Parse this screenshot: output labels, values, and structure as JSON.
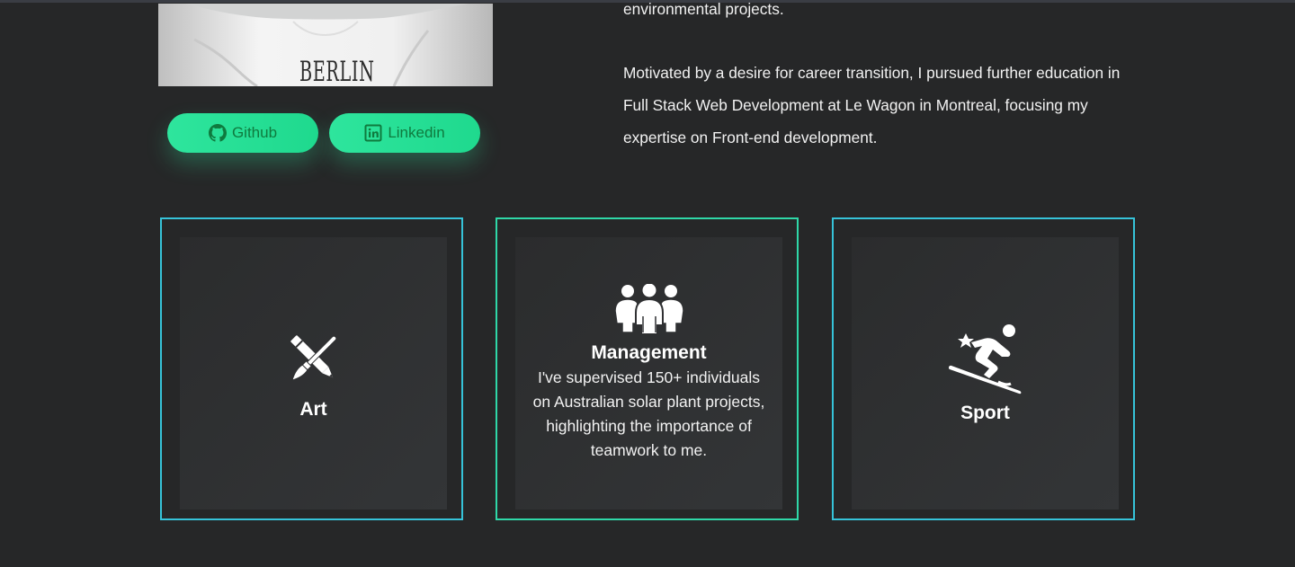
{
  "profile": {
    "shirt_text": "BERLIN"
  },
  "social": {
    "github_label": "Github",
    "linkedin_label": "Linkedin"
  },
  "about": {
    "para1_tail": "environmental projects.",
    "para2": "Motivated by a desire for career transition, I pursued further education in Full Stack Web Development at Le Wagon in Montreal, focusing my expertise on Front-end development."
  },
  "cards": [
    {
      "title": "Art",
      "icon": "pencil-brush-icon",
      "border_color": "#36c3d9"
    },
    {
      "title": "Management",
      "icon": "people-group-icon",
      "border_color": "#2fd8a8",
      "description": "I've supervised 150+ individuals on Australian solar plant projects, highlighting the importance of teamwork to me."
    },
    {
      "title": "Sport",
      "icon": "skiing-icon",
      "border_color": "#36c3d9"
    }
  ],
  "colors": {
    "background": "#262728",
    "accent_green": "#2ee59d",
    "button_text": "#0f7a3e",
    "card_border": "#36c3d9"
  }
}
